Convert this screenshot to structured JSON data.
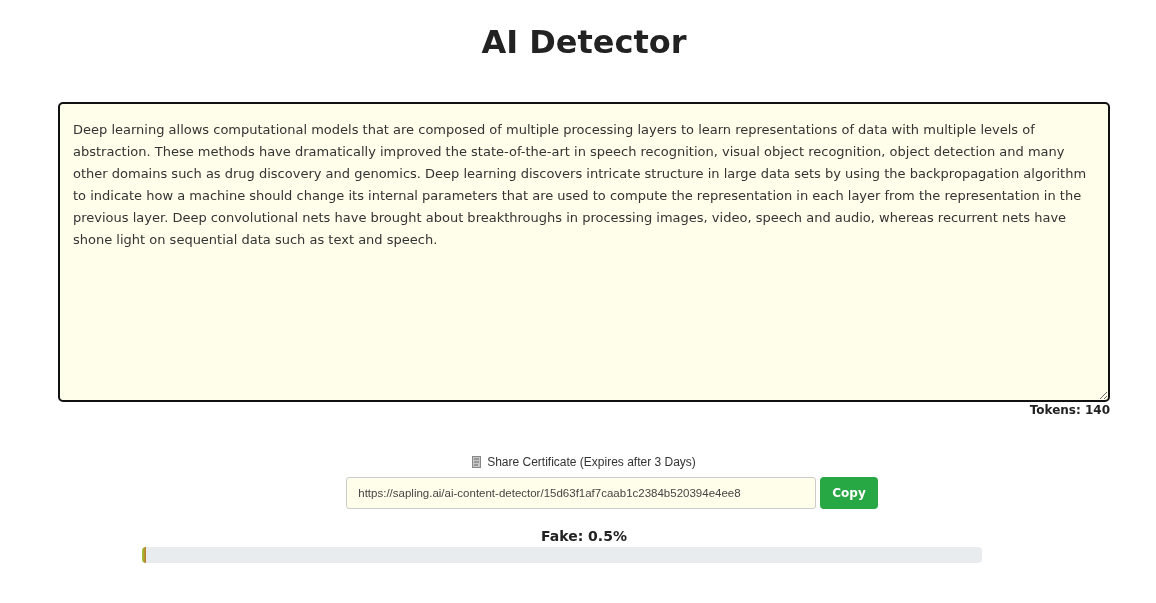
{
  "title": "AI Detector",
  "input": {
    "value": "Deep learning allows computational models that are composed of multiple processing layers to learn representations of data with multiple levels of abstraction. These methods have dramatically improved the state-of-the-art in speech recognition, visual object recognition, object detection and many other domains such as drug discovery and genomics. Deep learning discovers intricate structure in large data sets by using the backpropagation algorithm to indicate how a machine should change its internal parameters that are used to compute the representation in each layer from the representation in the previous layer. Deep convolutional nets have brought about breakthroughs in processing images, video, speech and audio, whereas recurrent nets have shone light on sequential data such as text and speech."
  },
  "tokens": "Tokens: 140",
  "share": {
    "label": "Share Certificate (Expires after 3 Days)",
    "url": "https://sapling.ai/ai-content-detector/15d63f1af7caab1c2384b520394e4ee8",
    "button": "Copy"
  },
  "result": {
    "label": "Fake: 0.5%",
    "level": 0.005
  }
}
